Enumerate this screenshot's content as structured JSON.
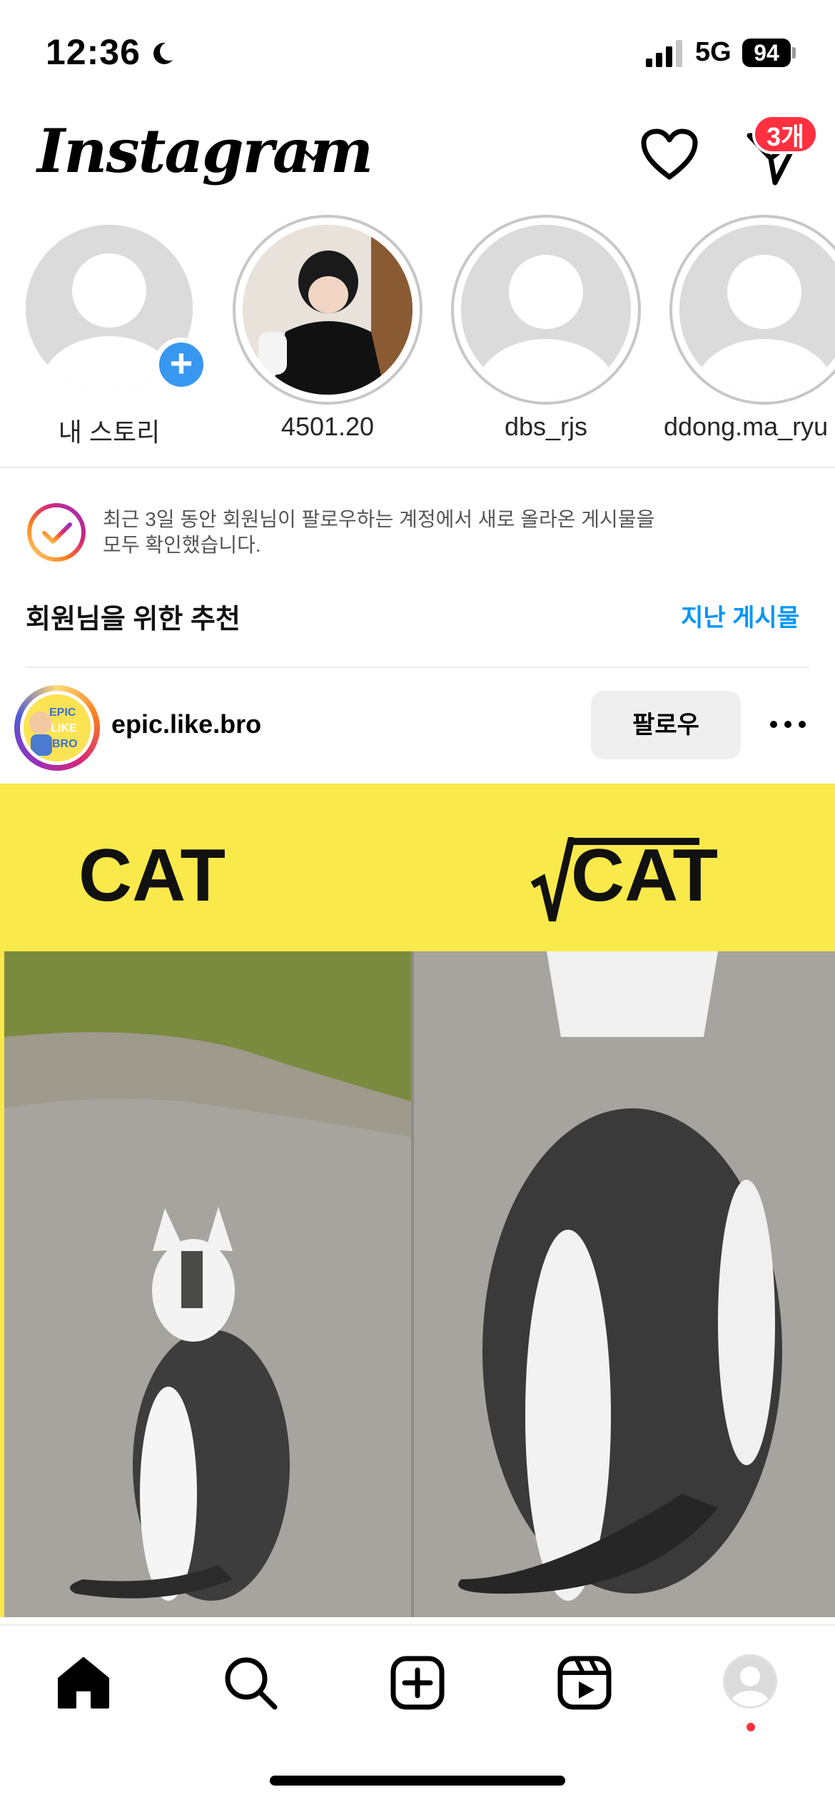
{
  "status_bar": {
    "time": "12:36",
    "network": "5G",
    "battery": "94"
  },
  "header": {
    "logo": "Instagram",
    "dm_badge": "3개"
  },
  "stories": [
    {
      "label": "내 스토리",
      "own": true
    },
    {
      "label": "4501.20"
    },
    {
      "label": "dbs_rjs"
    },
    {
      "label": "ddong.ma_ryu"
    }
  ],
  "feed": {
    "caught_up_text": "최근 3일 동안 회원님이 팔로우하는 계정에서 새로 올라온 게시물을\n모두 확인했습니다.",
    "recommended_title": "회원님을 위한 추천",
    "past_posts_link": "지난 게시물"
  },
  "post": {
    "username": "epic.like.bro",
    "follow_label": "팔로우",
    "avatar_text": "EPIC LIKE BRO",
    "image_text_left": "CAT",
    "image_text_right": "CAT"
  },
  "colors": {
    "accent": "#0095f6",
    "badge": "#ff3040",
    "meme_yellow": "#f9e94b"
  }
}
